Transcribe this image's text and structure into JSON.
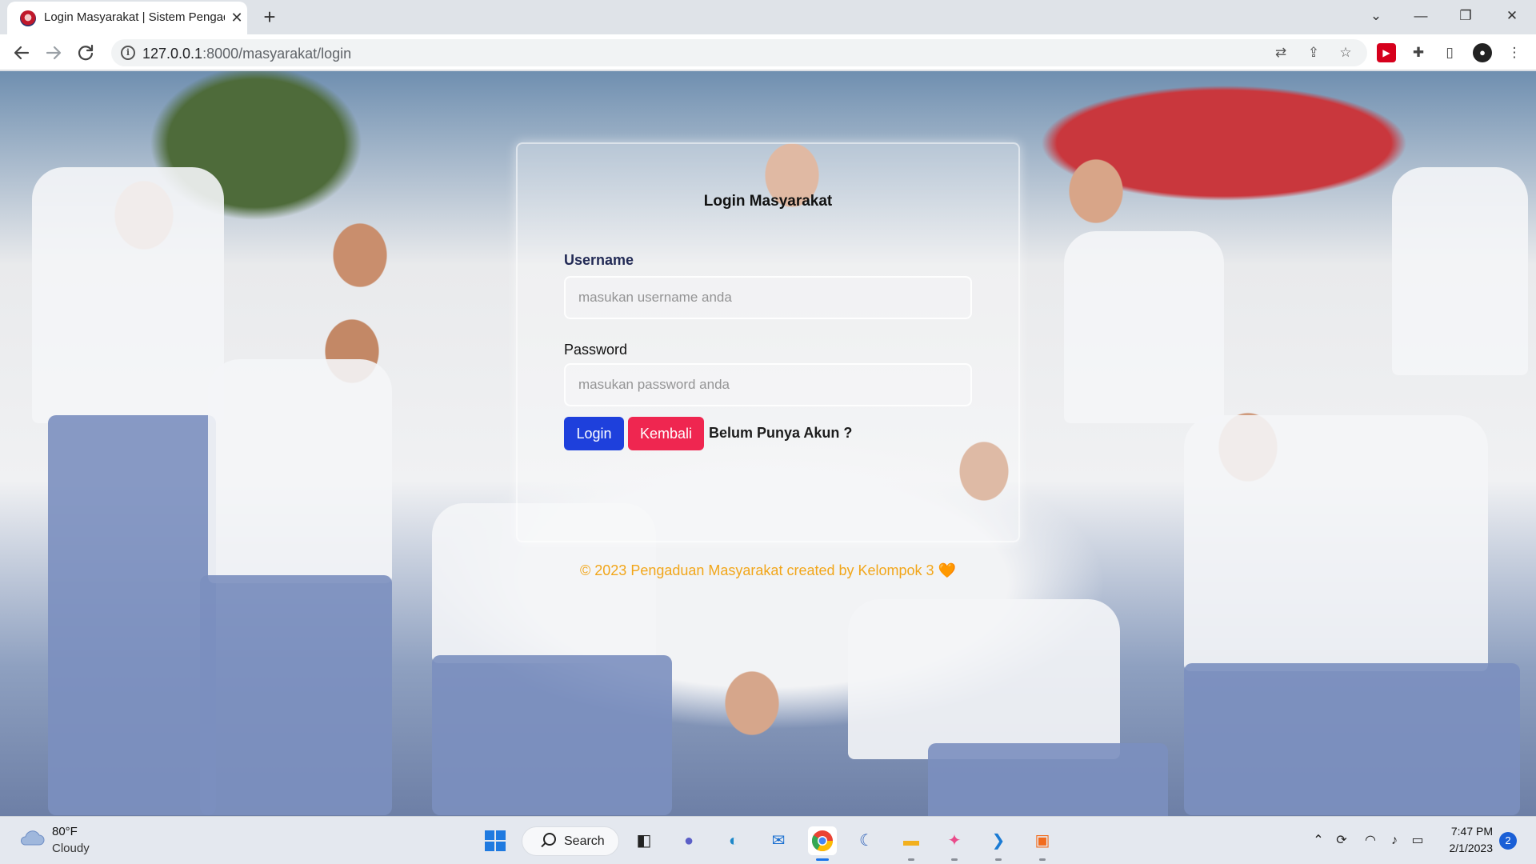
{
  "browser": {
    "tab_title": "Login Masyarakat | Sistem Pengaduan",
    "tab_close": "✕",
    "new_tab": "+",
    "url_host": "127.0.0.1",
    "url_path": ":8000/masyarakat/login",
    "window_controls": [
      "⌄",
      "—",
      "❐",
      "✕"
    ],
    "nav_icons": [
      "back-icon",
      "forward-icon",
      "reload-icon"
    ],
    "omnibox_icons": [
      "translate-icon",
      "share-icon",
      "bookmark-star-icon"
    ],
    "extension_icons": [
      "youtube-extension-icon",
      "puzzle-extensions-icon",
      "side-panel-icon",
      "profile-avatar-icon",
      "menu-more-icon"
    ]
  },
  "page": {
    "title": "Login Masyarakat",
    "username_label": "Username",
    "username_placeholder": "masukan username anda",
    "password_label": "Password",
    "password_placeholder": "masukan password anda",
    "login_button": "Login",
    "back_button": "Kembali",
    "register_link": "Belum Punya Akun ?",
    "footer": "© 2023 Pengaduan Masyarakat created by Kelompok 3 🧡",
    "accent_colors": {
      "login": "#1e40dc",
      "back": "#ef2650",
      "footer": "#f2a61a"
    }
  },
  "taskbar": {
    "weather_temp": "80°F",
    "weather_desc": "Cloudy",
    "search_label": "Search",
    "apps": [
      "start-icon",
      "task-view-icon",
      "teams-chat-icon",
      "edge-icon",
      "mail-icon",
      "chrome-icon",
      "app-icon",
      "file-explorer-icon",
      "app-icon",
      "vscode-icon",
      "app-icon"
    ],
    "clock_time": "7:47 PM",
    "clock_date": "2/1/2023",
    "notifications": "2"
  }
}
